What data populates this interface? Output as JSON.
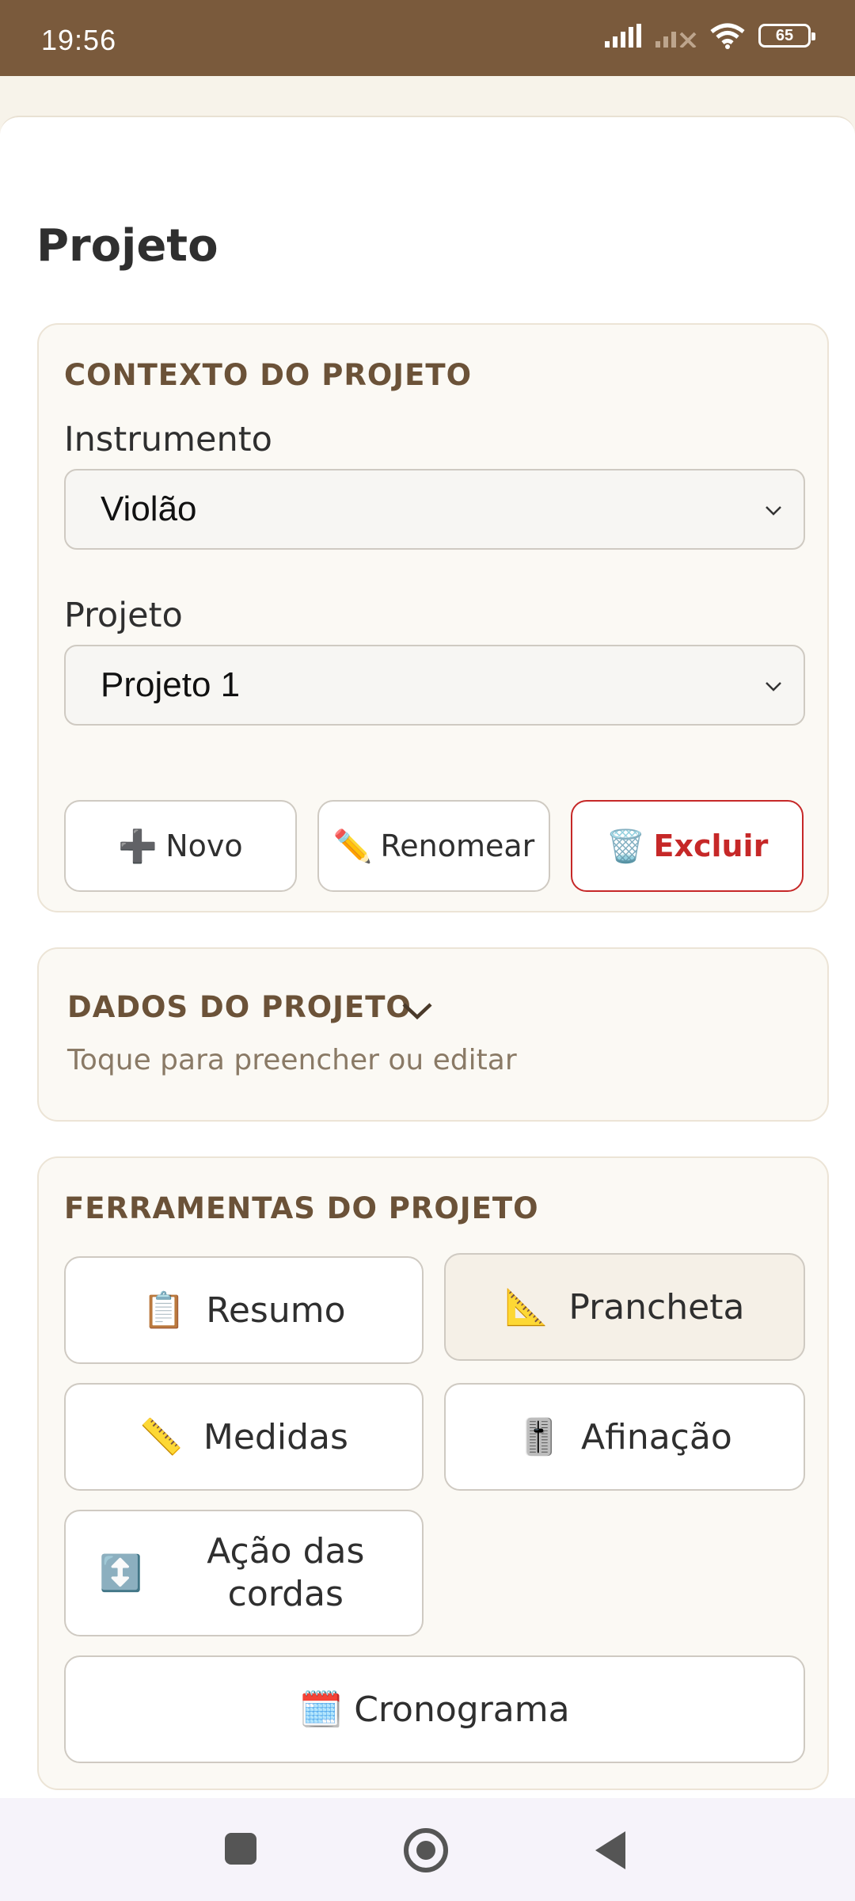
{
  "status": {
    "time": "19:56",
    "battery": "65"
  },
  "page": {
    "title": "Projeto"
  },
  "context": {
    "section_title": "CONTEXTO DO PROJETO",
    "instrument_label": "Instrumento",
    "instrument_value": "Violão",
    "project_label": "Projeto",
    "project_value": "Projeto 1",
    "actions": {
      "new_icon": "➕",
      "new_label": "Novo",
      "rename_icon": "✏️",
      "rename_label": "Renomear",
      "delete_icon": "🗑️",
      "delete_label": "Excluir"
    }
  },
  "dados": {
    "section_title": "DADOS DO PROJETO",
    "subtitle": "Toque para preencher ou editar"
  },
  "tools": {
    "section_title": "FERRAMENTAS DO PROJETO",
    "resumo": {
      "icon": "📋",
      "label": "Resumo"
    },
    "prancheta": {
      "icon": "📐",
      "label": "Prancheta"
    },
    "medidas": {
      "icon": "📏",
      "label": "Medidas"
    },
    "afinacao": {
      "icon": "🎚️",
      "label": "Afinação"
    },
    "acao": {
      "icon": "↕️",
      "label": "Ação das cordas"
    },
    "cronograma": {
      "icon": "🗓️",
      "label": "Cronograma"
    }
  },
  "colors": {
    "status_bar": "#7a5a3c",
    "accent_title": "#6b5238",
    "danger": "#c62828"
  }
}
